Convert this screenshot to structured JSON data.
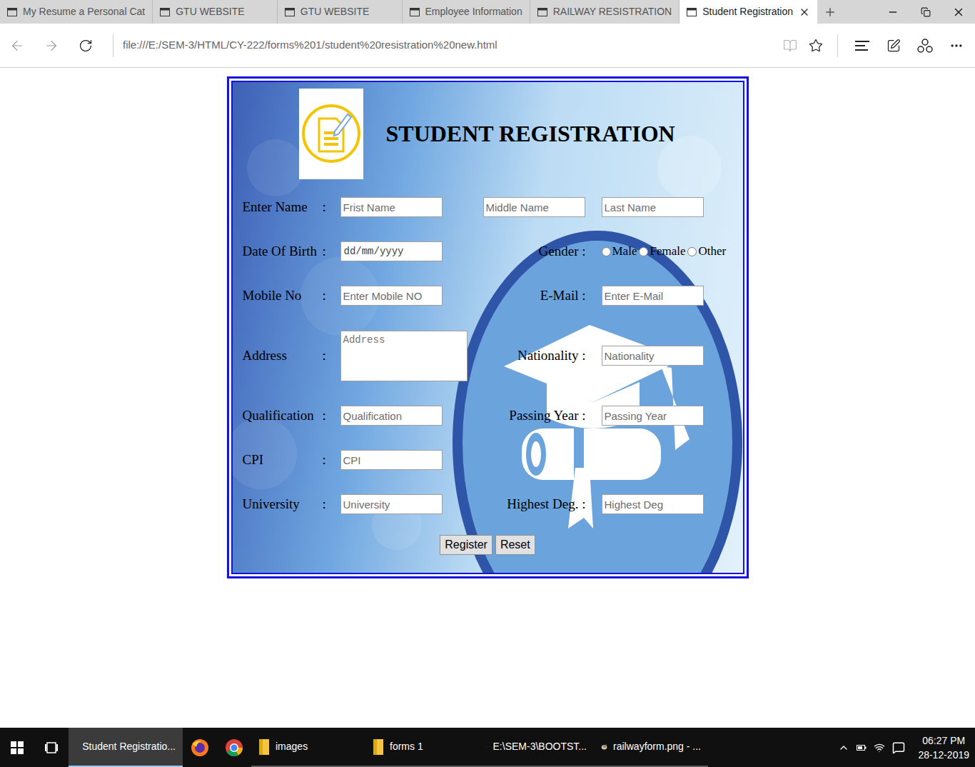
{
  "browser": {
    "tabs": [
      {
        "label": "My Resume a Personal Cat",
        "selected": false
      },
      {
        "label": "GTU WEBSITE",
        "selected": false
      },
      {
        "label": "GTU WEBSITE",
        "selected": false
      },
      {
        "label": "Employee Information",
        "selected": false
      },
      {
        "label": "RAILWAY RESISTRATION",
        "selected": false
      },
      {
        "label": "Student Registration",
        "selected": true
      }
    ],
    "url": "file:///E:/SEM-3/HTML/CY-222/forms%201/student%20resistration%20new.html"
  },
  "form": {
    "title": "STUDENT REGISTRATION",
    "rows": [
      {
        "kind": "triple",
        "label": "Enter Name",
        "separator": ":",
        "fields": [
          {
            "kind": "text",
            "placeholder": "Frist Name"
          },
          {
            "kind": "text",
            "placeholder": "Middle Name"
          },
          {
            "kind": "text",
            "placeholder": "Last Name"
          }
        ]
      },
      {
        "kind": "pair",
        "label": "Date Of Birth",
        "separator": ":",
        "fields": [
          {
            "kind": "date",
            "placeholder": "dd/mm/yyyy"
          }
        ],
        "right": {
          "label": "Gender :",
          "kind": "radio",
          "options": [
            {
              "label": "Male",
              "selected": false
            },
            {
              "label": "Female",
              "selected": false
            },
            {
              "label": "Other",
              "selected": false
            }
          ]
        }
      },
      {
        "kind": "pair",
        "label": "Mobile No",
        "separator": ":",
        "fields": [
          {
            "kind": "text",
            "placeholder": "Enter Mobile NO"
          }
        ],
        "right": {
          "label": "E-Mail :",
          "kind": "text",
          "placeholder": "Enter E-Mail"
        }
      },
      {
        "kind": "pair",
        "label": "Address",
        "separator": ":",
        "fields": [
          {
            "kind": "textarea",
            "placeholder": "Address"
          }
        ],
        "right": {
          "label": "Nationality :",
          "kind": "text",
          "placeholder": "Nationality"
        }
      },
      {
        "kind": "pair",
        "label": "Qualification",
        "separator": ":",
        "fields": [
          {
            "kind": "text",
            "placeholder": "Qualification"
          }
        ],
        "right": {
          "label": "Passing Year :",
          "kind": "text",
          "placeholder": "Passing Year"
        }
      },
      {
        "kind": "single",
        "label": "CPI",
        "separator": ":",
        "fields": [
          {
            "kind": "text",
            "placeholder": "CPI"
          }
        ]
      },
      {
        "kind": "pair",
        "label": "University",
        "separator": ":",
        "fields": [
          {
            "kind": "text",
            "placeholder": "University"
          }
        ],
        "right": {
          "label": "Highest Deg. :",
          "kind": "text",
          "placeholder": "Highest Deg"
        }
      }
    ],
    "buttons": [
      "Register",
      "Reset"
    ]
  },
  "taskbar": {
    "items": [
      {
        "kind": "window",
        "label": "Student Registratio...",
        "selected": true
      },
      {
        "kind": "pinned",
        "selected": false
      },
      {
        "kind": "pinned",
        "selected": false
      },
      {
        "kind": "window",
        "label": "images",
        "selected": false
      },
      {
        "kind": "window",
        "label": "forms 1",
        "selected": false
      },
      {
        "kind": "window",
        "label": "E:\\SEM-3\\BOOTST...",
        "selected": false
      },
      {
        "kind": "window",
        "label": "railwayform.png - ...",
        "selected": false
      }
    ],
    "clock": {
      "time": "06:27 PM",
      "date": "28-12-2019"
    }
  }
}
